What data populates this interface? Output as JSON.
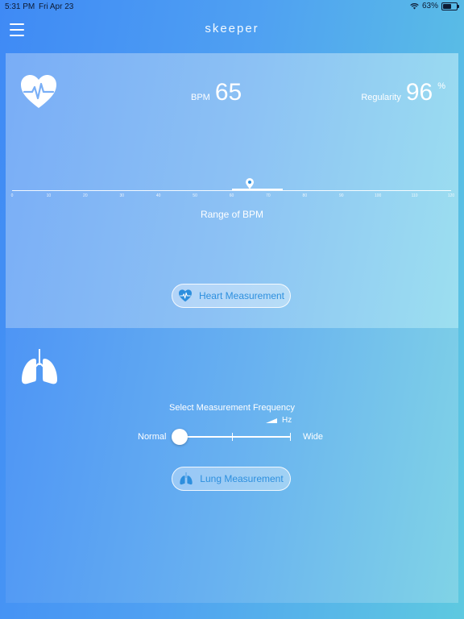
{
  "status": {
    "time": "5:31 PM",
    "date": "Fri Apr 23",
    "battery": "63%",
    "battery_level": 0.63
  },
  "header": {
    "title": "skeeper"
  },
  "heart": {
    "bpm_label": "BPM",
    "bpm_value": "65",
    "regularity_label": "Regularity",
    "regularity_value": "96",
    "regularity_unit": "%",
    "range_label": "Range of BPM",
    "range_ticks": [
      "0",
      "10",
      "20",
      "30",
      "40",
      "50",
      "60",
      "70",
      "80",
      "90",
      "100",
      "110",
      "120"
    ],
    "range_min": 0,
    "range_max": 120,
    "marker_value": 65,
    "highlight_range": [
      60,
      74
    ],
    "button_label": "Heart Measurement"
  },
  "lung": {
    "frequency_title": "Select Measurement Frequency",
    "hz_label": "Hz",
    "normal_label": "Normal",
    "wide_label": "Wide",
    "slider_value": 0,
    "button_label": "Lung Measurement"
  },
  "colors": {
    "accent": "#2d8fde",
    "white": "#ffffff"
  }
}
